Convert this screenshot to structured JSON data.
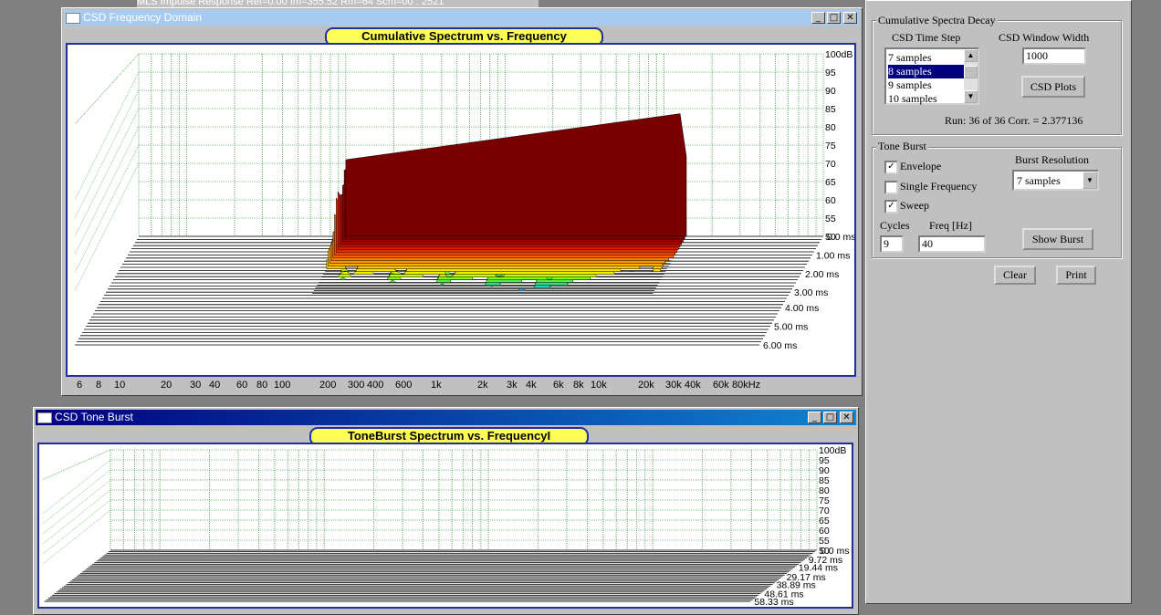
{
  "background_title": "MLS Impulse Response Ref=0.00 Im=355.52 Rm=64 Scm=00 : 2521",
  "csd_window": {
    "title": "CSD Frequency Domain",
    "chart_title": "Cumulative Spectrum vs. Frequency",
    "buttons": {
      "min": "_",
      "max": "□",
      "close": "✕"
    }
  },
  "tone_window": {
    "title": "CSD Tone Burst",
    "chart_title": "ToneBurst Spectrum vs. FrequencyI",
    "buttons": {
      "min": "_",
      "max": "□",
      "close": "✕"
    }
  },
  "chart_data": [
    {
      "type": "area",
      "title": "Cumulative Spectrum vs. Frequency",
      "y_unit": "dB",
      "y_ticks": [
        "100dB",
        "95",
        "90",
        "85",
        "80",
        "75",
        "70",
        "65",
        "60",
        "55",
        "50"
      ],
      "z_ticks": [
        "0.0 ms",
        "1.00 ms",
        "2.00 ms",
        "3.00 ms",
        "4.00 ms",
        "5.00 ms",
        "6.00 ms"
      ],
      "x_ticks": [
        "6",
        "8",
        "10",
        "20",
        "30",
        "40",
        "60",
        "80",
        "100",
        "200",
        "300",
        "400",
        "600",
        "1k",
        "2k",
        "3k",
        "4k",
        "6k",
        "8k",
        "10k",
        "20k",
        "30k",
        "40k",
        "60k",
        "80kHz"
      ],
      "x_scale": "log",
      "grid": true,
      "colors": {
        "early": "#7a0000",
        "mid": "#ff6000",
        "late": "#80ff20",
        "latest": "#0040ff"
      }
    },
    {
      "type": "area",
      "title": "ToneBurst Spectrum vs. FrequencyI",
      "y_ticks": [
        "100dB",
        "95",
        "90",
        "85",
        "80",
        "75",
        "70",
        "65",
        "60",
        "55",
        "50"
      ],
      "z_ticks": [
        "0.0 ms",
        "9.72 ms",
        "19.44 ms",
        "29.17 ms",
        "38.89 ms",
        "48.61 ms",
        "58.33 ms"
      ],
      "x_scale": "log",
      "grid": true
    }
  ],
  "panel": {
    "csd_group_title": "Cumulative Spectra Decay",
    "time_step_label": "CSD Time Step",
    "time_step_items": [
      "7 samples",
      "8 samples",
      "9 samples",
      "10 samples"
    ],
    "time_step_selected": "8 samples",
    "window_width_label": "CSD Window Width",
    "window_width_value": "1000",
    "csd_plots_button": "CSD Plots",
    "run_status": "Run: 36 of 36 Corr. = 2.377136",
    "tone_group_title": "Tone Burst",
    "envelope_label": "Envelope",
    "envelope_checked": true,
    "single_freq_label": "Single Frequency",
    "single_freq_checked": false,
    "sweep_label": "Sweep",
    "sweep_checked": true,
    "burst_res_label": "Burst Resolution",
    "burst_res_value": "7 samples",
    "cycles_label": "Cycles",
    "cycles_value": "9",
    "freq_label": "Freq [Hz]",
    "freq_value": "40",
    "show_burst_button": "Show Burst",
    "clear_button": "Clear",
    "print_button": "Print",
    "check_glyph": "✓"
  }
}
